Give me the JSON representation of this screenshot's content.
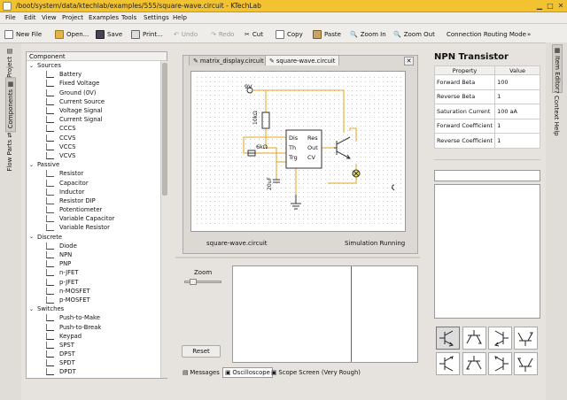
{
  "window": {
    "title": "/boot/system/data/ktechlab/examples/555/square-wave.circuit - KTechLab"
  },
  "menu": [
    "File",
    "Edit",
    "View",
    "Project",
    "Examples",
    "Tools",
    "Settings",
    "Help"
  ],
  "toolbar": {
    "new_file": "New File",
    "open": "Open...",
    "save": "Save",
    "print": "Print...",
    "undo": "Undo",
    "redo": "Redo",
    "cut": "Cut",
    "copy": "Copy",
    "paste": "Paste",
    "zoom_in": "Zoom In",
    "zoom_out": "Zoom Out",
    "routing": "Connection Routing Mode",
    "more": "»"
  },
  "left_tabs": {
    "project": "Project",
    "components": "Components",
    "flow_parts": "Flow Parts"
  },
  "components": {
    "header": "Component",
    "categories": [
      {
        "name": "Sources",
        "items": [
          "Battery",
          "Fixed Voltage",
          "Ground (0V)",
          "Current Source",
          "Voltage Signal",
          "Current Signal",
          "CCCS",
          "CCVS",
          "VCCS",
          "VCVS"
        ]
      },
      {
        "name": "Passive",
        "items": [
          "Resistor",
          "Capacitor",
          "Inductor",
          "Resistor DIP",
          "Potentiometer",
          "Variable Capacitor",
          "Variable Resistor"
        ]
      },
      {
        "name": "Discrete",
        "items": [
          "Diode",
          "NPN",
          "PNP",
          "n-JFET",
          "p-JFET",
          "n-MOSFET",
          "p-MOSFET"
        ]
      },
      {
        "name": "Switches",
        "items": [
          "Push-to-Make",
          "Push-to-Break",
          "Keypad",
          "SPST",
          "DPST",
          "SPDT",
          "DPDT"
        ]
      }
    ]
  },
  "tabs": [
    {
      "label": "matrix_display.circuit"
    },
    {
      "label": "square-wave.circuit"
    }
  ],
  "circuit": {
    "voltage": "9V",
    "r1": "10kΩ",
    "r2": "6kΩ",
    "cap": "20uF",
    "pins_left": [
      "Dis",
      "Th",
      "Trg"
    ],
    "pins_right": [
      "Res",
      "Out",
      "CV"
    ]
  },
  "status": {
    "file": "square-wave.circuit",
    "state": "Simulation Running"
  },
  "oscilloscope": {
    "zoom_label": "Zoom",
    "zoom_level": 0.15,
    "reset": "Reset"
  },
  "bottom_tabs": {
    "messages": "Messages",
    "oscilloscope": "Oscilloscope",
    "scope_screen": "Scope Screen (Very Rough)"
  },
  "item_editor": {
    "title": "NPN Transistor",
    "col_property": "Property",
    "col_value": "Value",
    "rows": [
      {
        "property": "Forward Beta",
        "value": "100"
      },
      {
        "property": "Reverse Beta",
        "value": "1"
      },
      {
        "property": "Saturation Current",
        "value": "100 aA"
      },
      {
        "property": "Forward Coefficient",
        "value": "1"
      },
      {
        "property": "Reverse Coefficient",
        "value": "1"
      }
    ]
  },
  "right_tabs": {
    "item_editor": "Item Editor",
    "context_help": "Context Help"
  },
  "colors": {
    "titlebar": "#f2c230",
    "wire_orange": "#e8a31a",
    "component_dark": "#333333"
  }
}
